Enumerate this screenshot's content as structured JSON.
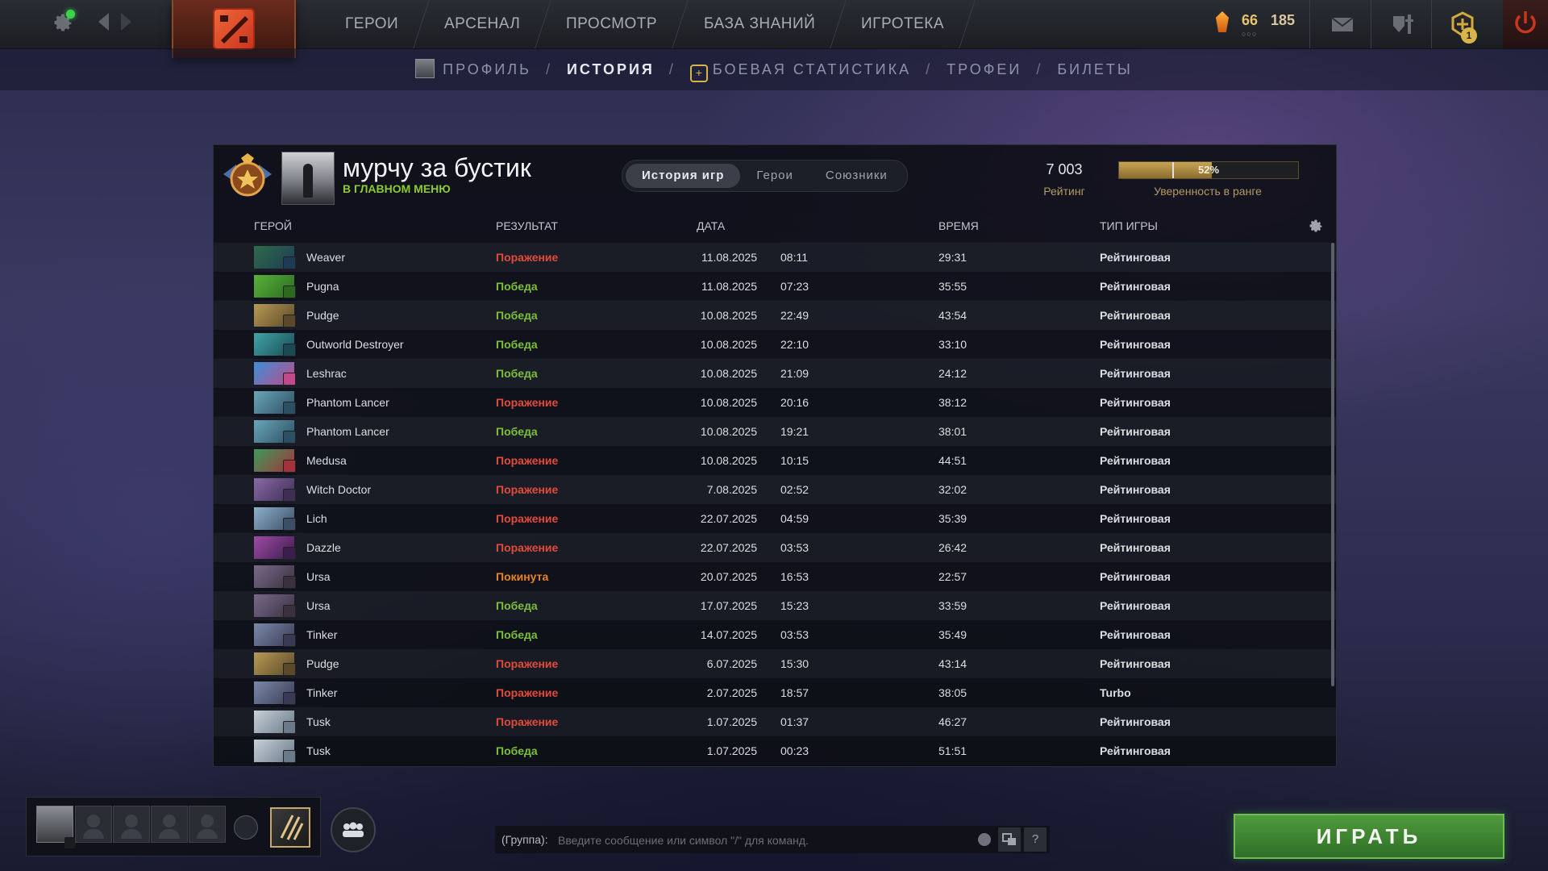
{
  "topnav": {
    "items": [
      "Герои",
      "Арсенал",
      "Просмотр",
      "База знаний",
      "Игротека"
    ],
    "level": "66",
    "shards": "185",
    "plus_badge": "1"
  },
  "subnav": {
    "profile": "Профиль",
    "history": "История",
    "battle_stats": "Боевая статистика",
    "trophies": "Трофеи",
    "tickets": "Билеты",
    "separator": "/"
  },
  "player": {
    "name": "мурчу за бустик",
    "status": "В главном меню"
  },
  "tabs": [
    "История игр",
    "Герои",
    "Союзники"
  ],
  "rating": {
    "value": "7 003",
    "label": "Рейтинг",
    "confidence_percent": 52,
    "confidence_text": "52%",
    "confidence_label": "Уверенность в ранге"
  },
  "table": {
    "headers": {
      "hero": "Герой",
      "result": "Результат",
      "date": "Дата",
      "time": "Время",
      "type": "Тип игры"
    },
    "rows": [
      {
        "hero": "Weaver",
        "result": "Поражение",
        "kind": "loss",
        "date": "11.08.2025",
        "clock": "08:11",
        "duration": "29:31",
        "mode": "Рейтинговая"
      },
      {
        "hero": "Pugna",
        "result": "Победа",
        "kind": "win",
        "date": "11.08.2025",
        "clock": "07:23",
        "duration": "35:55",
        "mode": "Рейтинговая"
      },
      {
        "hero": "Pudge",
        "result": "Победа",
        "kind": "win",
        "date": "10.08.2025",
        "clock": "22:49",
        "duration": "43:54",
        "mode": "Рейтинговая"
      },
      {
        "hero": "Outworld Destroyer",
        "result": "Победа",
        "kind": "win",
        "date": "10.08.2025",
        "clock": "22:10",
        "duration": "33:10",
        "mode": "Рейтинговая"
      },
      {
        "hero": "Leshrac",
        "result": "Победа",
        "kind": "win",
        "date": "10.08.2025",
        "clock": "21:09",
        "duration": "24:12",
        "mode": "Рейтинговая"
      },
      {
        "hero": "Phantom Lancer",
        "result": "Поражение",
        "kind": "loss",
        "date": "10.08.2025",
        "clock": "20:16",
        "duration": "38:12",
        "mode": "Рейтинговая"
      },
      {
        "hero": "Phantom Lancer",
        "result": "Победа",
        "kind": "win",
        "date": "10.08.2025",
        "clock": "19:21",
        "duration": "38:01",
        "mode": "Рейтинговая"
      },
      {
        "hero": "Medusa",
        "result": "Поражение",
        "kind": "loss",
        "date": "10.08.2025",
        "clock": "10:15",
        "duration": "44:51",
        "mode": "Рейтинговая"
      },
      {
        "hero": "Witch Doctor",
        "result": "Поражение",
        "kind": "loss",
        "date": "7.08.2025",
        "clock": "02:52",
        "duration": "32:02",
        "mode": "Рейтинговая"
      },
      {
        "hero": "Lich",
        "result": "Поражение",
        "kind": "loss",
        "date": "22.07.2025",
        "clock": "04:59",
        "duration": "35:39",
        "mode": "Рейтинговая"
      },
      {
        "hero": "Dazzle",
        "result": "Поражение",
        "kind": "loss",
        "date": "22.07.2025",
        "clock": "03:53",
        "duration": "26:42",
        "mode": "Рейтинговая"
      },
      {
        "hero": "Ursa",
        "result": "Покинута",
        "kind": "abandon",
        "date": "20.07.2025",
        "clock": "16:53",
        "duration": "22:57",
        "mode": "Рейтинговая"
      },
      {
        "hero": "Ursa",
        "result": "Победа",
        "kind": "win",
        "date": "17.07.2025",
        "clock": "15:23",
        "duration": "33:59",
        "mode": "Рейтинговая"
      },
      {
        "hero": "Tinker",
        "result": "Победа",
        "kind": "win",
        "date": "14.07.2025",
        "clock": "03:53",
        "duration": "35:49",
        "mode": "Рейтинговая"
      },
      {
        "hero": "Pudge",
        "result": "Поражение",
        "kind": "loss",
        "date": "6.07.2025",
        "clock": "15:30",
        "duration": "43:14",
        "mode": "Рейтинговая"
      },
      {
        "hero": "Tinker",
        "result": "Поражение",
        "kind": "loss",
        "date": "2.07.2025",
        "clock": "18:57",
        "duration": "38:05",
        "mode": "Turbo"
      },
      {
        "hero": "Tusk",
        "result": "Поражение",
        "kind": "loss",
        "date": "1.07.2025",
        "clock": "01:37",
        "duration": "46:27",
        "mode": "Рейтинговая"
      },
      {
        "hero": "Tusk",
        "result": "Победа",
        "kind": "win",
        "date": "1.07.2025",
        "clock": "00:23",
        "duration": "51:51",
        "mode": "Рейтинговая"
      }
    ]
  },
  "hero_colors": {
    "Weaver": [
      "#2f6b4a",
      "#1d3b55"
    ],
    "Pugna": [
      "#58b33a",
      "#2c6a1e"
    ],
    "Pudge": [
      "#b79a55",
      "#5b4a2a"
    ],
    "Outworld Destroyer": [
      "#3fa6a6",
      "#1b4a55"
    ],
    "Leshrac": [
      "#3b8fd6",
      "#c04a8a"
    ],
    "Phantom Lancer": [
      "#6aa7b8",
      "#2b4f63"
    ],
    "Medusa": [
      "#3d9a5a",
      "#a3323a"
    ],
    "Witch Doctor": [
      "#8a6aa6",
      "#3e2e55"
    ],
    "Lich": [
      "#8fb0c8",
      "#3a4f66"
    ],
    "Dazzle": [
      "#a04aa6",
      "#3b1e4d"
    ],
    "Ursa": [
      "#7a6a8a",
      "#3a3040"
    ],
    "Tinker": [
      "#7a8aa8",
      "#3b3a55"
    ],
    "Tusk": [
      "#c8d0d8",
      "#6a7a8a"
    ]
  },
  "colors": {
    "loss": "#e24a3b",
    "win": "#7cbf3a",
    "abandon": "#e6832b",
    "play_green": "#4f9a3c",
    "gold": "#b39a60"
  },
  "icons": {
    "settings": "gear-icon",
    "mail": "mail-icon",
    "armory": "armory-icon",
    "plus": "dota-plus-icon",
    "power": "power-icon"
  },
  "chat": {
    "channel": "(Группа):",
    "placeholder": "Введите сообщение или символ \"/\" для команд.",
    "help": "?"
  },
  "play": {
    "label": "ИГРАТЬ"
  }
}
